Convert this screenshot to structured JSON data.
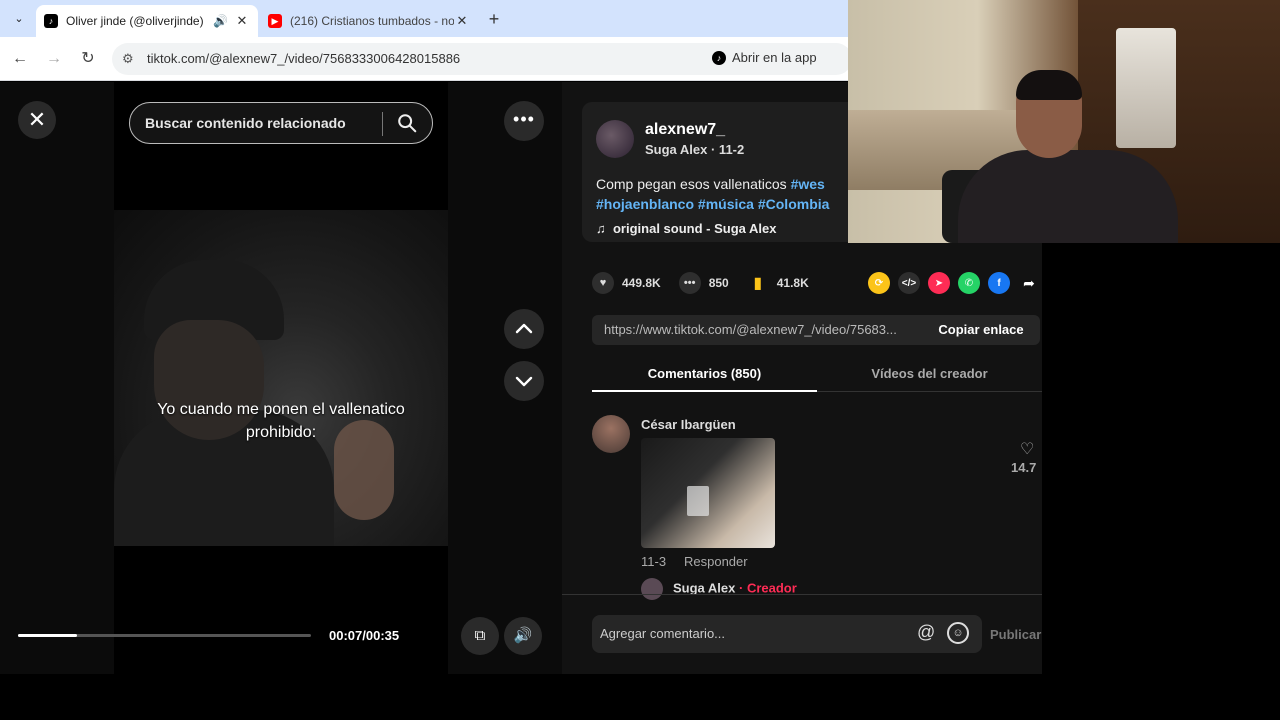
{
  "browser": {
    "tabs": [
      {
        "title": "Oliver jinde (@oliverjinde) |",
        "active": true,
        "favicon": "tiktok-icon"
      },
      {
        "title": "(216) Cristianos tumbados - no",
        "active": false,
        "favicon": "youtube-icon"
      }
    ],
    "new_tab_label": "+",
    "url": "tiktok.com/@alexnew7_/video/7568333006428015886",
    "open_app_label": "Abrir en la app"
  },
  "video": {
    "search_placeholder": "Buscar contenido relacionado",
    "caption_line1": "Yo cuando me ponen el vallenatico",
    "caption_line2": "prohibido:",
    "time": "00:07/00:35",
    "progress_fraction": 0.2
  },
  "post": {
    "username": "alexnew7_",
    "nickname_date": "Suga Alex · 11-2",
    "description_text": "Comp pegan esos vallenaticos ",
    "hashtags": [
      "#wes",
      "#hojaenblanco",
      "#música",
      "#Colombia"
    ],
    "sound": "original sound - Suga Alex",
    "likes": "449.8K",
    "comments_count": "850",
    "saves": "41.8K",
    "link": "https://www.tiktok.com/@alexnew7_/video/75683...",
    "copy_link_label": "Copiar enlace"
  },
  "panel_tabs": {
    "comments": "Comentarios (850)",
    "creator_videos": "Vídeos del creador"
  },
  "comment": {
    "author": "César Ibargüen",
    "date": "11-3",
    "reply_label": "Responder",
    "likes": "14.7",
    "reply_author": "Suga Alex",
    "reply_separator": " · ",
    "reply_badge": "Creador"
  },
  "composer": {
    "placeholder": "Agregar comentario...",
    "publish_label": "Publicar"
  },
  "colors": {
    "accent_red": "#fe2c55",
    "hashtag_blue": "#64b5f6"
  }
}
